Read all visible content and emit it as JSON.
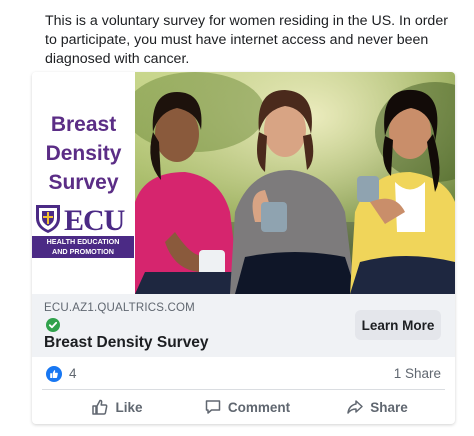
{
  "post": {
    "text": "This is a voluntary survey for women residing in the US. In order to participate, you must have internet access and never been diagnosed with cancer."
  },
  "ad": {
    "title_lines": [
      "Breast",
      "Density",
      "Survey"
    ],
    "logo_text": "ECU",
    "logo_bar_line1": "HEALTH EDUCATION",
    "logo_bar_line2": "AND PROMOTION",
    "brand_color": "#5b2d86"
  },
  "link": {
    "domain": "ECU.AZ1.QUALTRICS.COM",
    "title": "Breast Density Survey",
    "cta_label": "Learn More",
    "verified_icon": "check-circle-icon",
    "verified_color": "#31a24c"
  },
  "stats": {
    "reactions": "4",
    "shares": "1 Share",
    "reaction_icon": "thumbs-up-icon"
  },
  "actions": {
    "like_label": "Like",
    "comment_label": "Comment",
    "share_label": "Share"
  },
  "colors": {
    "facebook_blue": "#1877f2",
    "muted_text": "#606770",
    "link_bg": "#f0f2f5"
  }
}
